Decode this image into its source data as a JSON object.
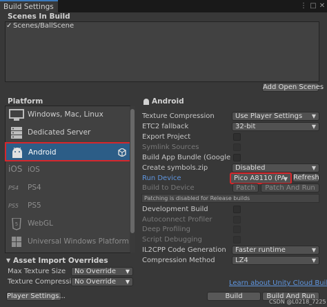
{
  "window": {
    "tab_title": "Build Settings",
    "more_icon": "⋮",
    "maximize_icon": "□",
    "close_icon": "✕"
  },
  "scenes": {
    "header": "Scenes In Build",
    "items": [
      {
        "label": "Scenes/BallScene",
        "checked": true
      }
    ],
    "add_open_scenes": "Add Open Scenes"
  },
  "platform": {
    "header": "Platform",
    "items": [
      {
        "label": "Windows, Mac, Linux",
        "icon": "monitor-icon",
        "selected": false
      },
      {
        "label": "Dedicated Server",
        "icon": "server-icon",
        "selected": false
      },
      {
        "label": "Android",
        "icon": "android-icon",
        "selected": true
      },
      {
        "label": "iOS",
        "icon": "ios-icon",
        "selected": false
      },
      {
        "label": "PS4",
        "icon": "ps4-icon",
        "selected": false
      },
      {
        "label": "PS5",
        "icon": "ps5-icon",
        "selected": false
      },
      {
        "label": "WebGL",
        "icon": "html5-icon",
        "selected": false
      },
      {
        "label": "Universal Windows Platform",
        "icon": "windows-logo-icon",
        "selected": false
      }
    ]
  },
  "settings": {
    "title": "Android",
    "texture_compression": {
      "label": "Texture Compression",
      "value": "Use Player Settings"
    },
    "etc2_fallback": {
      "label": "ETC2 fallback",
      "value": "32-bit"
    },
    "export_project": {
      "label": "Export Project"
    },
    "symlink_sources": {
      "label": "Symlink Sources"
    },
    "build_app_bundle": {
      "label": "Build App Bundle (Google Play)"
    },
    "create_symbols": {
      "label": "Create symbols.zip",
      "value": "Disabled"
    },
    "run_device": {
      "label": "Run Device",
      "value": "Pico A8110 (PA",
      "refresh": "Refresh"
    },
    "build_to_device": {
      "label": "Build to Device",
      "patch": "Patch",
      "patch_and_run": "Patch And Run"
    },
    "patching_note": "Patching is disabled for Release builds",
    "development_build": {
      "label": "Development Build"
    },
    "autoconnect_profiler": {
      "label": "Autoconnect Profiler"
    },
    "deep_profiling": {
      "label": "Deep Profiling"
    },
    "script_debugging": {
      "label": "Script Debugging"
    },
    "il2cpp": {
      "label": "IL2CPP Code Generation",
      "value": "Faster runtime"
    },
    "compression": {
      "label": "Compression Method",
      "value": "LZ4"
    }
  },
  "asset_import": {
    "header": "Asset Import Overrides",
    "max_texture": {
      "label": "Max Texture Size",
      "value": "No Override"
    },
    "texture_compression": {
      "label": "Texture Compression",
      "value": "No Override"
    }
  },
  "footer": {
    "cloud_link": "Learn about Unity Cloud Build",
    "player_settings": "Player Settings...",
    "build": "Build",
    "build_and_run": "Build And Run",
    "watermark": "CSDN @L0218_7225"
  },
  "colors": {
    "selected_platform": "#2c5d87",
    "highlight_red": "#d8262b",
    "link_blue": "#5f96e0"
  }
}
